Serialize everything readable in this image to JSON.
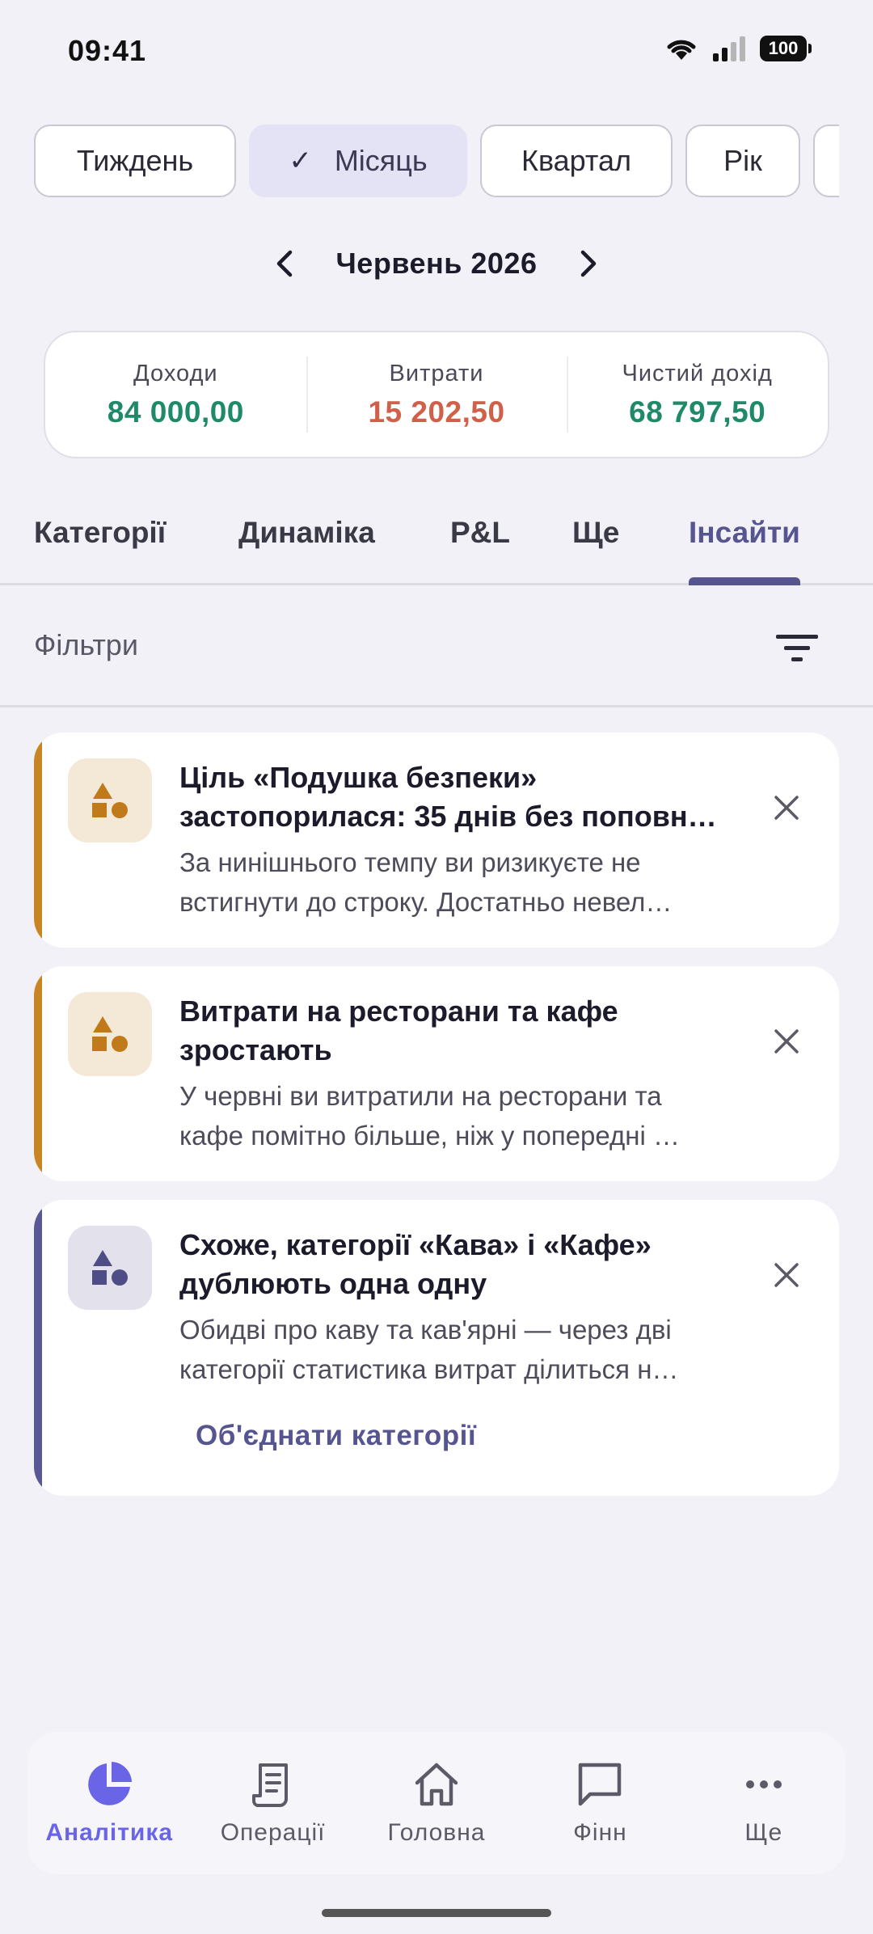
{
  "status_bar": {
    "time": "09:41",
    "battery": "100"
  },
  "periods": [
    {
      "label": "Тиждень",
      "selected": false
    },
    {
      "label": "Місяць",
      "selected": true
    },
    {
      "label": "Квартал",
      "selected": false
    },
    {
      "label": "Рік",
      "selected": false
    }
  ],
  "month": {
    "label": "Червень 2026"
  },
  "summary": {
    "income": {
      "label": "Доходи",
      "value": "84 000,00",
      "color": "#1f8a6a"
    },
    "expenses": {
      "label": "Витрати",
      "value": "15 202,50",
      "color": "#d0604a"
    },
    "net": {
      "label": "Чистий дохід",
      "value": "68 797,50",
      "color": "#1f8a6a"
    }
  },
  "tabs": [
    {
      "label": "Категорії",
      "active": false
    },
    {
      "label": "Динаміка",
      "active": false
    },
    {
      "label": "P&L",
      "active": false
    },
    {
      "label": "Ще",
      "active": false
    },
    {
      "label": "Інсайти",
      "active": true
    }
  ],
  "filters": {
    "label": "Фільтри"
  },
  "insights": [
    {
      "title_line1": "Ціль «Подушка безпеки»",
      "title_line2": "застопорилася: 35 днів без поповн…",
      "body_line1": "За нинішнього темпу ви ризикуєте не",
      "body_line2": "встигнути до строку. Достатньо невел…",
      "accent": "#c88622",
      "icon": "shapes-icon"
    },
    {
      "title_line1": "Витрати на ресторани та кафе",
      "title_line2": "зростають",
      "body_line1": "У червні ви витратили на ресторани та",
      "body_line2": "кафе помітно більше, ніж у попередні …",
      "accent": "#c88622",
      "icon": "shapes-icon"
    },
    {
      "title_line1": "Схоже, категорії «Кава» і «Кафе»",
      "title_line2": "дублюють одна одну",
      "body_line1": "Обидві про каву та кав'ярні — через дві",
      "body_line2": "категорії статистика витрат ділиться н…",
      "action": "Об'єднати категорії",
      "accent": "#5a5894",
      "icon": "shapes-icon"
    }
  ],
  "nav": [
    {
      "label": "Аналітика",
      "icon": "pie-chart-icon",
      "active": true
    },
    {
      "label": "Операції",
      "icon": "receipt-icon",
      "active": false
    },
    {
      "label": "Головна",
      "icon": "home-icon",
      "active": false
    },
    {
      "label": "Фінн",
      "icon": "chat-icon",
      "active": false
    },
    {
      "label": "Ще",
      "icon": "more-icon",
      "active": false
    }
  ],
  "colors": {
    "accent_purple": "#57558f",
    "warning_accent": "#c88622",
    "nav_active": "#6a65e6",
    "background": "#f1f1f7"
  }
}
